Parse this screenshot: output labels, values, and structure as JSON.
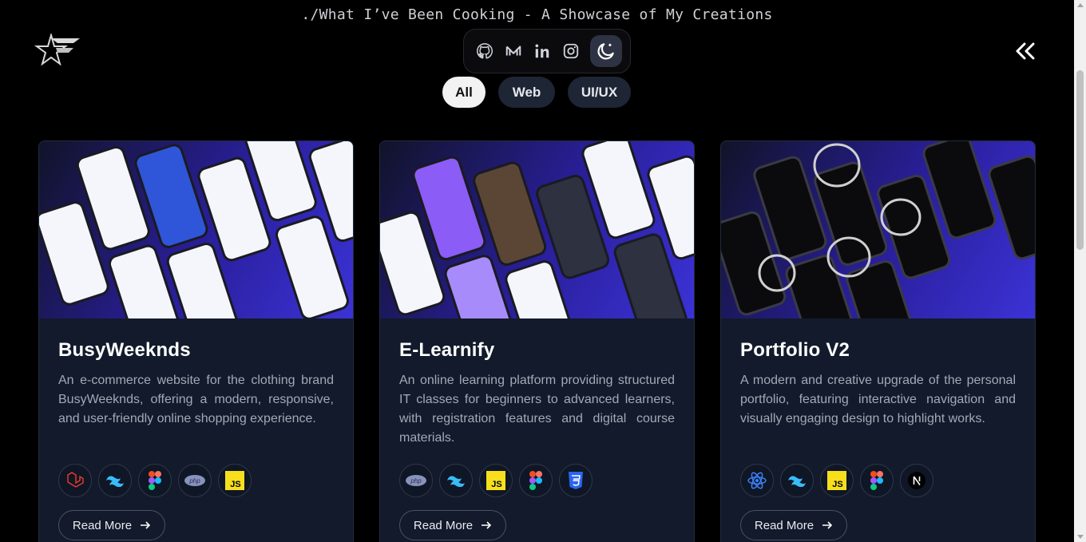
{
  "header": {
    "title": "./What I’ve Been Cooking - A Showcase of My Creations",
    "logo_icon": "star-logo-icon",
    "collapse_icon": "double-chevron-left-icon"
  },
  "social": [
    {
      "name": "github-icon"
    },
    {
      "name": "medium-icon"
    },
    {
      "name": "linkedin-icon"
    },
    {
      "name": "instagram-icon"
    },
    {
      "name": "theme-toggle-moon-icon"
    }
  ],
  "filters": [
    {
      "label": "All",
      "active": true
    },
    {
      "label": "Web",
      "active": false
    },
    {
      "label": "UI/UX",
      "active": false
    }
  ],
  "projects": [
    {
      "title": "BusyWeeknds",
      "description": "An e-commerce website for the clothing brand BusyWeeknds, offering a modern, responsive, and user-friendly online shopping experience.",
      "tech": [
        "laravel-icon",
        "tailwind-icon",
        "figma-icon",
        "php-icon",
        "javascript-icon"
      ],
      "read_more": "Read More"
    },
    {
      "title": "E-Learnify",
      "description": "An online learning platform providing structured IT classes for beginners to advanced learners, with registration features and digital course materials.",
      "tech": [
        "php-icon",
        "tailwind-icon",
        "javascript-icon",
        "figma-icon",
        "css3-icon"
      ],
      "read_more": "Read More"
    },
    {
      "title": "Portfolio V2",
      "description": "A modern and creative upgrade of the personal portfolio, featuring interactive navigation and visually engaging design to highlight works.",
      "tech": [
        "react-icon",
        "tailwind-icon",
        "javascript-icon",
        "figma-icon",
        "nextjs-icon"
      ],
      "read_more": "Read More"
    }
  ],
  "colors": {
    "background": "#000000",
    "card": "#121a2b",
    "accent": "#3b32d6",
    "pill_active": "#f2f2f2",
    "pill_inactive": "#1e2535"
  }
}
